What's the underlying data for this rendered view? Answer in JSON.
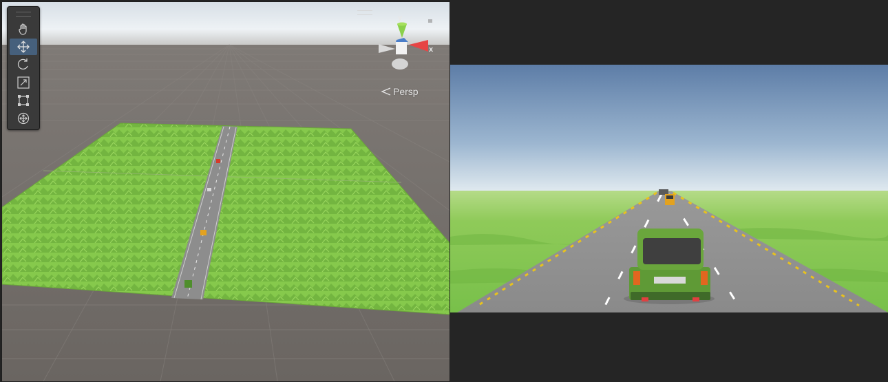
{
  "scene": {
    "projection_label": "Persp",
    "gizmo_axes": {
      "y": "y",
      "x": "x"
    },
    "tools": [
      {
        "name": "hand-tool",
        "icon": "hand-icon",
        "active": false
      },
      {
        "name": "move-tool",
        "icon": "move-icon",
        "active": true
      },
      {
        "name": "rotate-tool",
        "icon": "rotate-icon",
        "active": false
      },
      {
        "name": "scale-tool",
        "icon": "scale-icon",
        "active": false
      },
      {
        "name": "rect-tool",
        "icon": "rect-icon",
        "active": false
      },
      {
        "name": "transform-tool",
        "icon": "transform-icon",
        "active": false
      }
    ]
  },
  "colors": {
    "accent": "#46607c",
    "grass": "#7fc74a",
    "road": "#8d8d8d",
    "gizmo_y": "#8ad04a",
    "gizmo_x": "#e64545"
  }
}
